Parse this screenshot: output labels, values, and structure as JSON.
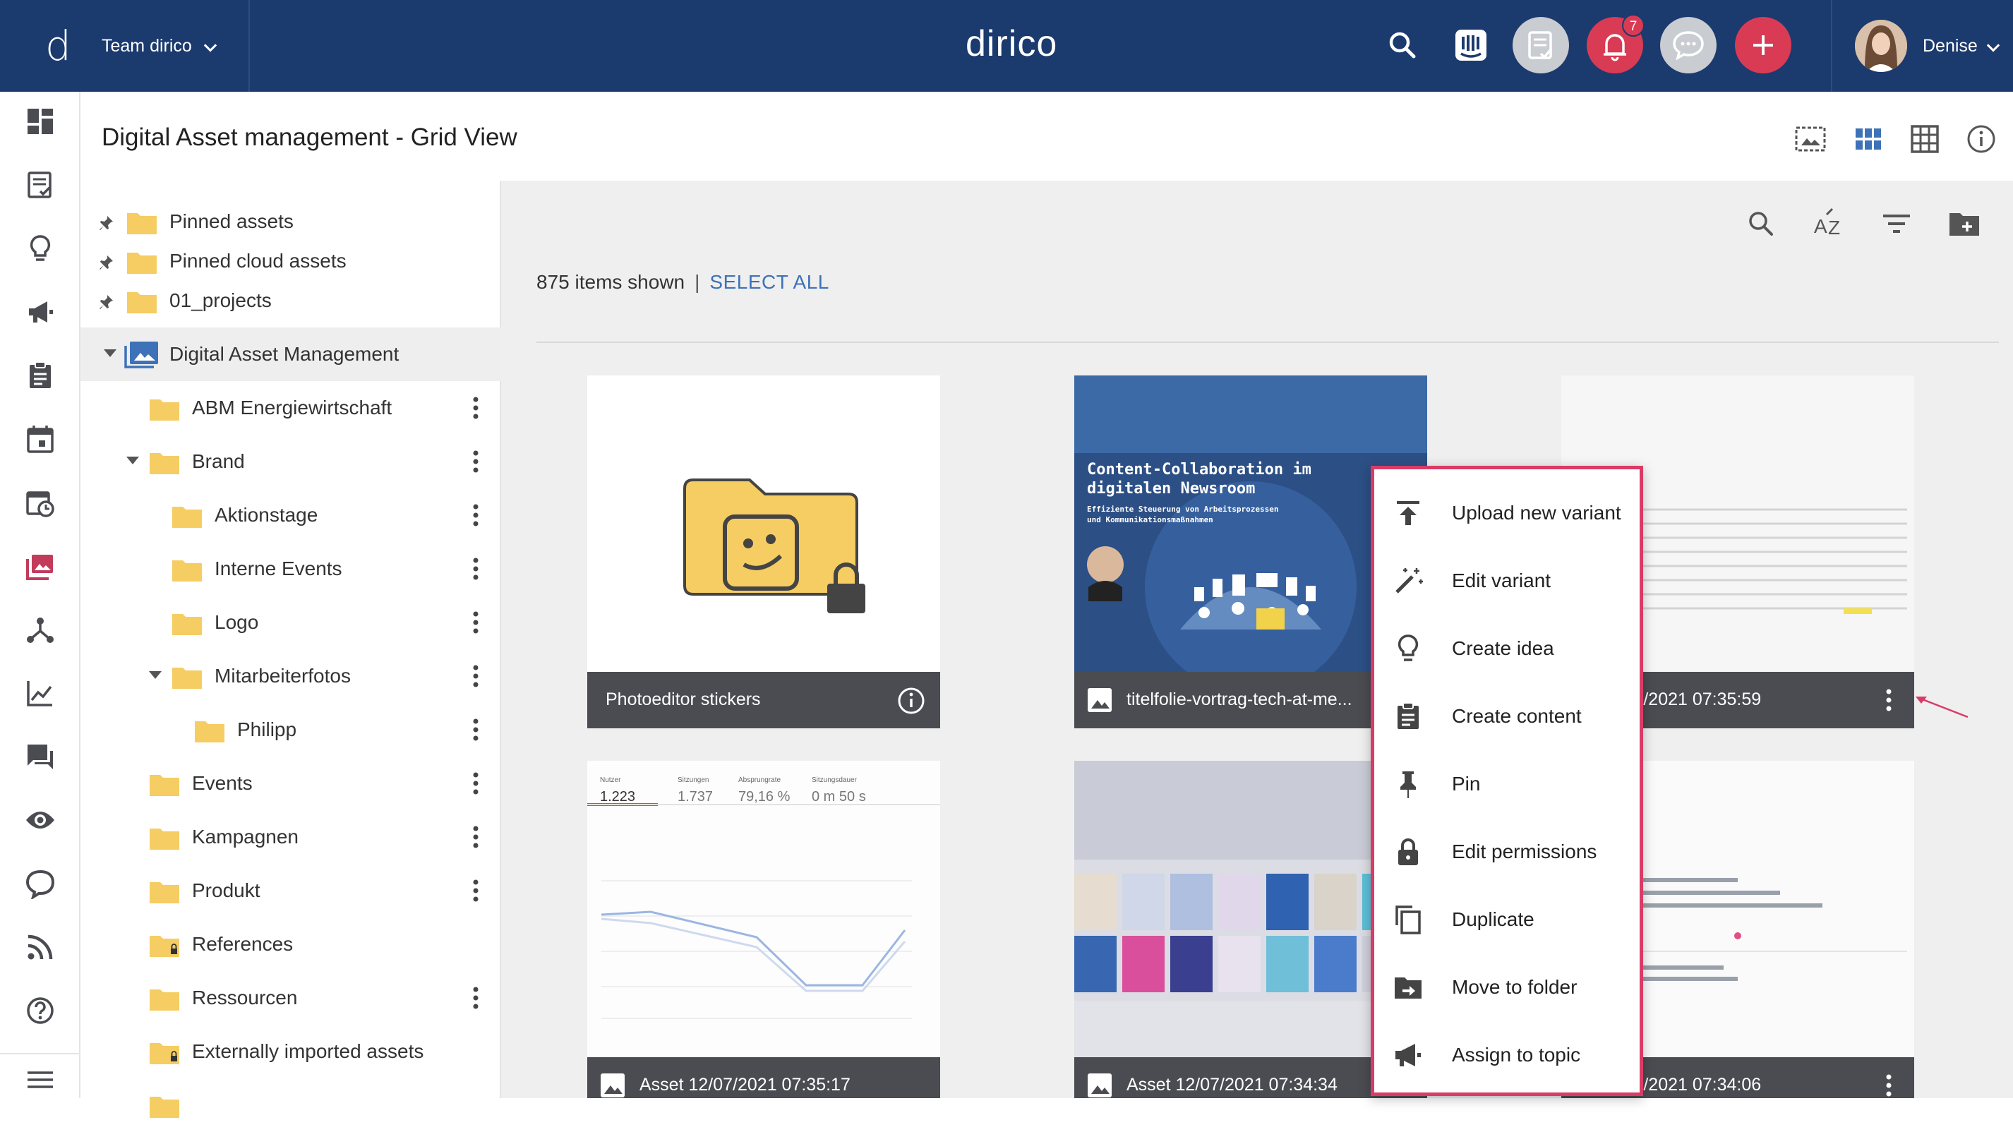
{
  "topbar": {
    "logo_letter": "d",
    "team_label": "Team dirico",
    "brand": "dirico",
    "notification_count": "7",
    "user_name": "Denise"
  },
  "page": {
    "title": "Digital Asset management - Grid View"
  },
  "tree": {
    "items": [
      {
        "label": "Pinned assets"
      },
      {
        "label": "Pinned cloud assets"
      },
      {
        "label": "01_projects"
      },
      {
        "label": "Digital Asset Management"
      },
      {
        "label": "ABM Energiewirtschaft"
      },
      {
        "label": "Brand"
      },
      {
        "label": "Aktionstage"
      },
      {
        "label": "Interne Events"
      },
      {
        "label": "Logo"
      },
      {
        "label": "Mitarbeiterfotos"
      },
      {
        "label": "Philipp"
      },
      {
        "label": "Events"
      },
      {
        "label": "Kampagnen"
      },
      {
        "label": "Produkt"
      },
      {
        "label": "References"
      },
      {
        "label": "Ressourcen"
      },
      {
        "label": "Externally imported assets"
      }
    ]
  },
  "content": {
    "items_shown": "875 items shown",
    "separator": "|",
    "select_all": "SELECT ALL"
  },
  "cards": [
    {
      "caption": "Photoeditor stickers"
    },
    {
      "caption": "titelfolie-vortrag-tech-at-me..."
    },
    {
      "caption": "et 12/07/2021 07:35:59"
    },
    {
      "caption": "Asset 12/07/2021 07:35:17"
    },
    {
      "caption": "Asset 12/07/2021 07:34:34"
    },
    {
      "caption": "et 12/07/2021 07:34:06"
    }
  ],
  "slide": {
    "headline_1": "Content-Collaboration im",
    "headline_2": "digitalen Newsroom",
    "sub_1": "Effiziente Steuerung von Arbeitsprozessen",
    "sub_2": "und Kommunikationsmaßnahmen"
  },
  "analytics": {
    "labels": [
      "Nutzer",
      "Sitzungen",
      "Absprungrate",
      "Sitzungsdauer"
    ],
    "values": [
      "1.223",
      "1.737",
      "79,16 %",
      "0 m 50 s"
    ]
  },
  "context_menu": {
    "items": [
      {
        "label": "Upload new variant",
        "icon": "upload-icon"
      },
      {
        "label": "Edit variant",
        "icon": "magic-wand-icon"
      },
      {
        "label": "Create idea",
        "icon": "lightbulb-icon"
      },
      {
        "label": "Create content",
        "icon": "clipboard-icon"
      },
      {
        "label": "Pin",
        "icon": "pin-icon"
      },
      {
        "label": "Edit permissions",
        "icon": "lock-icon"
      },
      {
        "label": "Duplicate",
        "icon": "duplicate-icon"
      },
      {
        "label": "Move to folder",
        "icon": "move-to-folder-icon"
      },
      {
        "label": "Assign to topic",
        "icon": "megaphone-icon"
      }
    ]
  },
  "colors": {
    "topbar": "#1b3a6e",
    "accent": "#d93b55",
    "menu_border": "#d93b67",
    "link": "#3d72b8",
    "folder": "#f5cd63"
  }
}
